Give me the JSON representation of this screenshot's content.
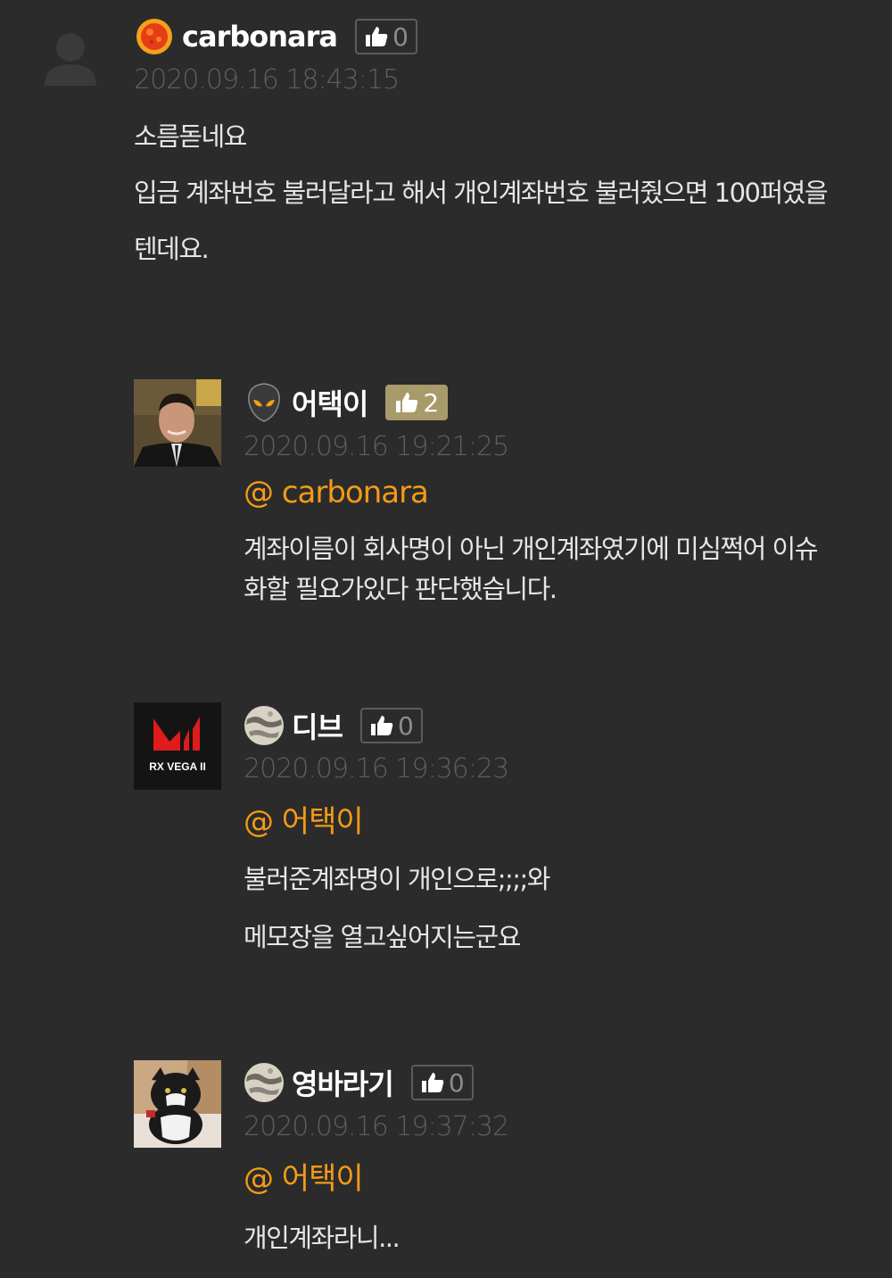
{
  "comments": [
    {
      "nickname": "carbonara",
      "likes": "0",
      "timestamp": "2020.09.16 18:43:15",
      "mention": "",
      "lines": [
        "소름돋네요",
        "입금 계좌번호 불러달라고 해서 개인계좌번호 불러줬으면 100퍼였을",
        "텐데요."
      ],
      "avatar": "default-user-avatar",
      "level_icon": "sun-level-icon"
    },
    {
      "nickname": "어택이",
      "likes": "2",
      "timestamp": "2020.09.16 19:21:25",
      "mention": "@ carbonara",
      "lines": [
        "계좌이름이 회사명이 아닌 개인계좌였기에 미심쩍어 이슈",
        "화할 필요가있다 판단했습니다."
      ],
      "avatar": "man-in-suit-photo",
      "level_icon": "alien-level-icon"
    },
    {
      "nickname": "디브",
      "likes": "0",
      "timestamp": "2020.09.16 19:36:23",
      "mention": "@ 어택이",
      "lines": [
        "불러준계좌명이 개인으로;;;;와",
        "메모장을 열고싶어지는군요"
      ],
      "avatar": "rx-vega-logo",
      "avatar_text": "RX VEGA II",
      "level_icon": "moon-level-icon"
    },
    {
      "nickname": "영바라기",
      "likes": "0",
      "timestamp": "2020.09.16 19:37:32",
      "mention": "@ 어택이",
      "lines": [
        "개인계좌라니..."
      ],
      "avatar": "cat-photo",
      "level_icon": "moon-level-icon"
    }
  ],
  "colors": {
    "background": "#2b2b2b",
    "mention": "#f29b16",
    "timestamp": "#5e5e5e",
    "like_highlight": "#a89a6a"
  }
}
